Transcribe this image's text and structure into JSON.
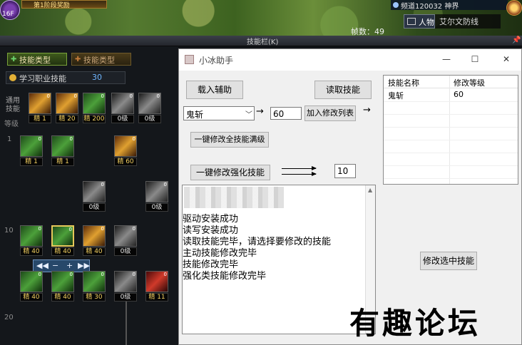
{
  "game": {
    "player_level": "16F",
    "quest_text": "第1阶段奖励",
    "channel": "频道120032 神界",
    "map_tag": "人物",
    "map_name": "艾尔文防线",
    "fatigue": "帧数：49"
  },
  "skill_window": {
    "title": "技能栏(K)",
    "tabs": [
      {
        "label": "技能类型",
        "icon": "plus-icon"
      },
      {
        "label": "技能类型",
        "icon": "plus-icon"
      }
    ],
    "learn_label": "学习职业技能",
    "learn_points": "30",
    "common_label": "通用技能",
    "grade_label": "等级",
    "row_levels": [
      "1",
      "10",
      "20"
    ],
    "common_skills": [
      {
        "level": "精 1",
        "tint": "o"
      },
      {
        "level": "精 20",
        "tint": "o"
      },
      {
        "level": "精 200",
        "tint": "g"
      },
      {
        "level": "0级",
        "tint": "w"
      },
      {
        "level": "0级",
        "tint": "w"
      }
    ],
    "row1_skills": [
      {
        "level": "精 1",
        "tint": "g"
      },
      {
        "level": "精 1",
        "tint": "g"
      },
      {
        "level": "精 60",
        "tint": "o"
      }
    ],
    "row_mid_skills": [
      {
        "level": "0级",
        "tint": "w"
      },
      {
        "level": "0级",
        "tint": "w"
      }
    ],
    "row10_skills": [
      {
        "level": "精 40",
        "tint": "g"
      },
      {
        "level": "精 40",
        "tint": "g"
      },
      {
        "level": "精 40",
        "tint": "o"
      },
      {
        "level": "0级",
        "tint": "w"
      }
    ],
    "row10b_skills": [
      {
        "level": "精 40",
        "tint": "g"
      },
      {
        "level": "精 40",
        "tint": "g"
      },
      {
        "level": "精 30",
        "tint": "g"
      },
      {
        "level": "0级",
        "tint": "w"
      },
      {
        "level": "精 11",
        "tint": "r"
      }
    ],
    "stepper": [
      "◀◀",
      "−",
      "+",
      "▶▶"
    ]
  },
  "helper": {
    "title": "小冰助手",
    "minimize": "—",
    "maximize": "☐",
    "close": "✕",
    "load_button": "载入辅助",
    "read_button": "读取技能",
    "skill_combo_value": "鬼斩",
    "arrow": "→",
    "level_input": "60",
    "add_button": "加入修改列表",
    "max_all_button": "一键修改全技能满级",
    "enhance_button": "一键修改强化技能",
    "enhance_value": "10",
    "modify_button": "修改选中技能",
    "log_lines": [
      "驱动安装成功",
      "读写安装成功",
      "读取技能完毕，请选择要修改的技能",
      "主动技能修改完毕",
      "技能修改完毕",
      "强化类技能修改完毕"
    ],
    "table": {
      "columns": [
        "技能名称",
        "修改等级"
      ],
      "rows": [
        [
          "鬼斩",
          "60"
        ]
      ]
    }
  },
  "watermark": "有趣论坛"
}
